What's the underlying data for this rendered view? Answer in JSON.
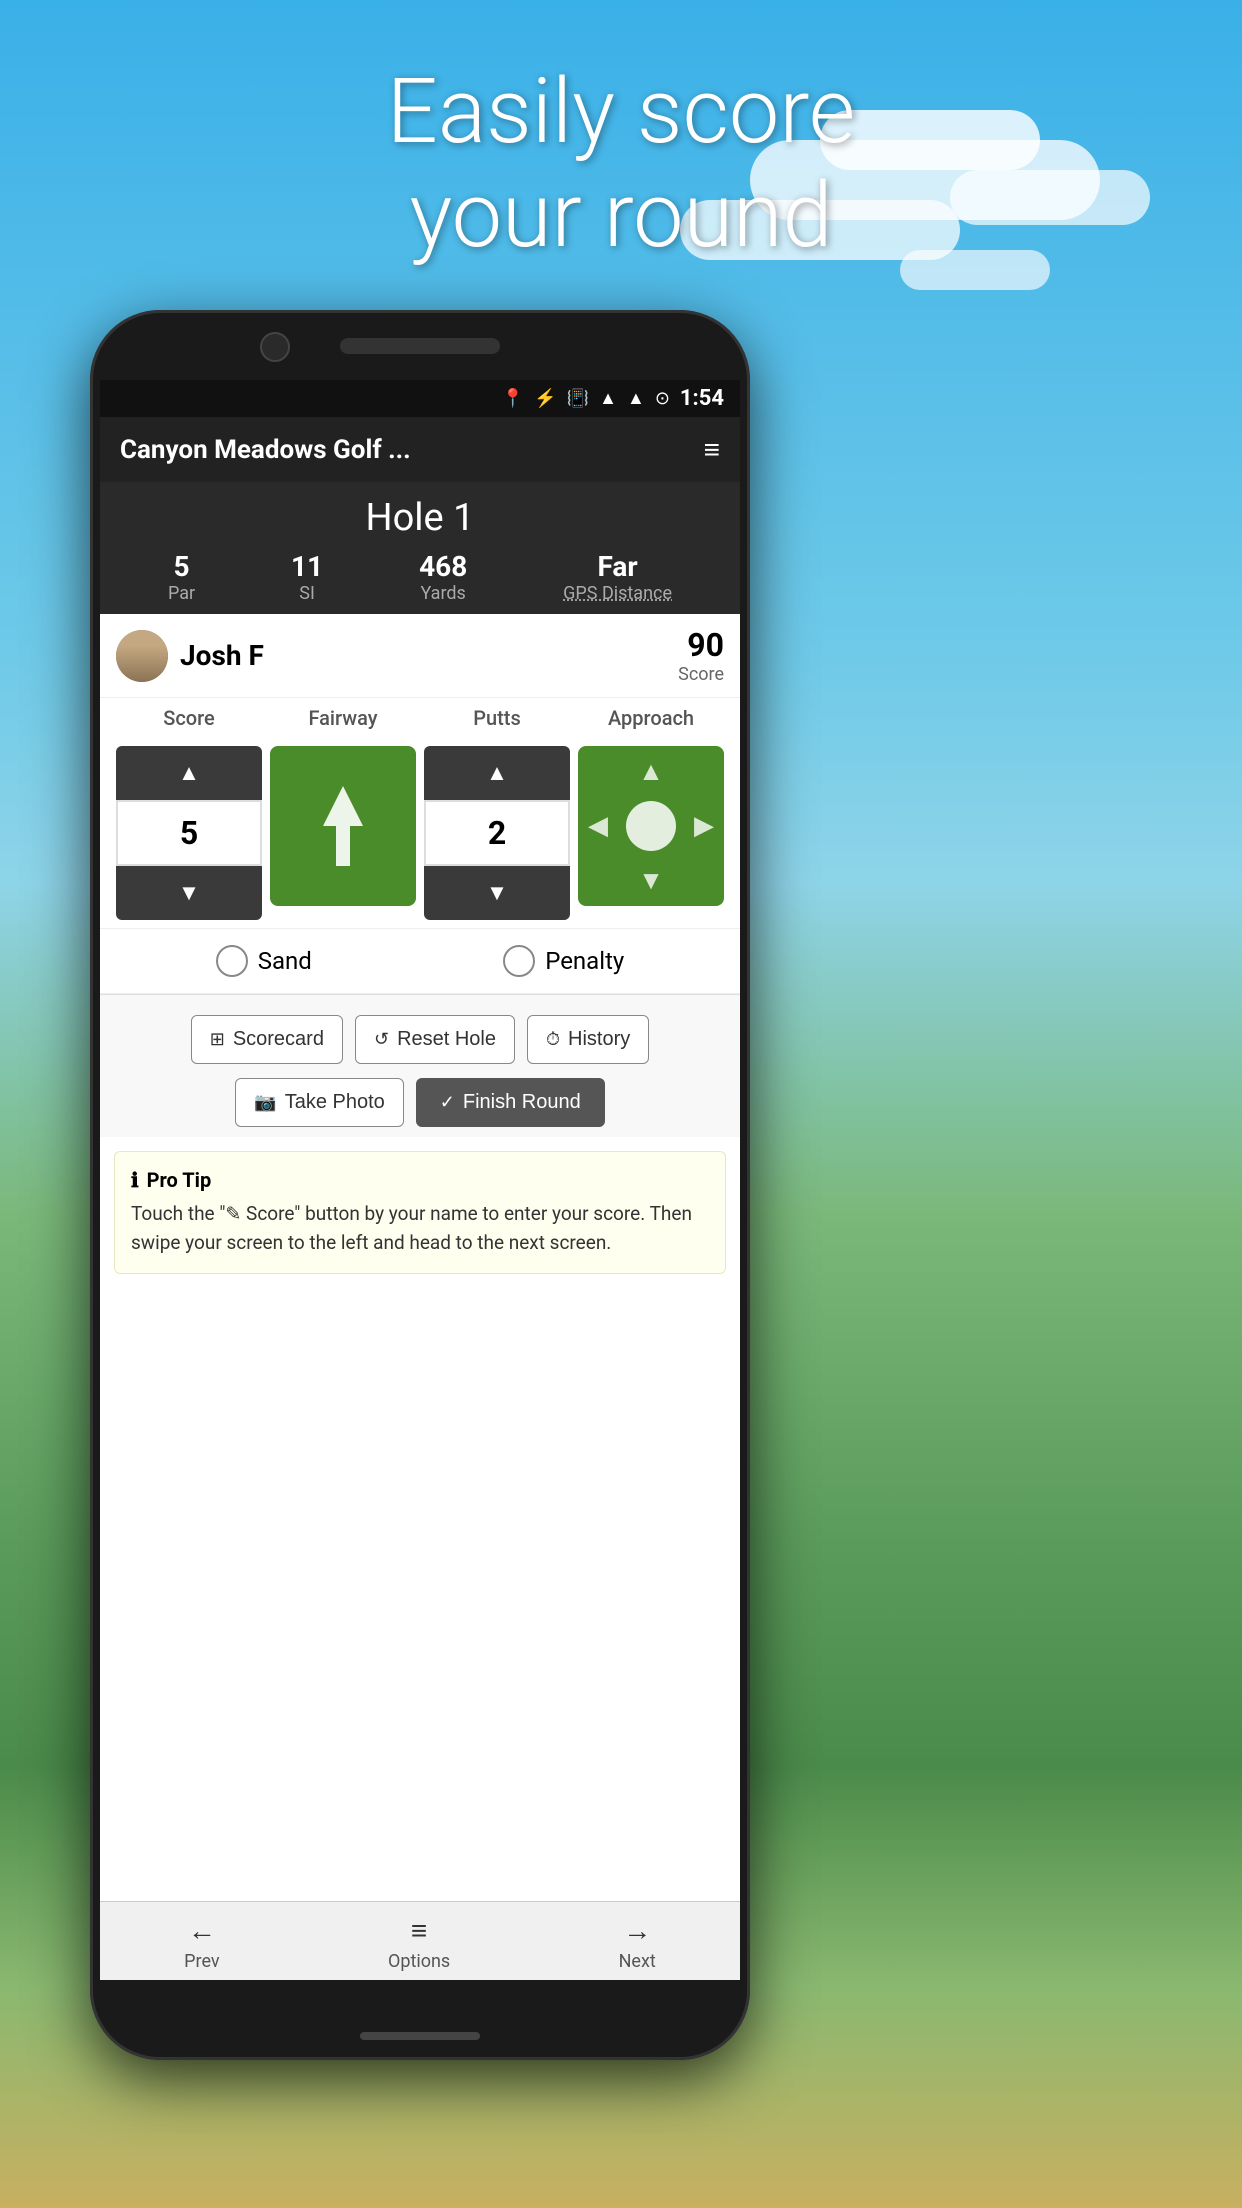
{
  "background": {
    "sky_color": "#3ab0e8",
    "grass_color": "#5a9a5a"
  },
  "hero": {
    "line1": "Easily score",
    "line2": "your round"
  },
  "status_bar": {
    "time": "1:54",
    "icons": [
      "location",
      "bluetooth",
      "vibrate",
      "wifi",
      "signal",
      "alarm"
    ]
  },
  "app_header": {
    "title": "Canyon Meadows Golf ...",
    "menu_icon": "≡"
  },
  "hole_info": {
    "title": "Hole 1",
    "par": {
      "value": "5",
      "label": "Par"
    },
    "si": {
      "value": "11",
      "label": "SI"
    },
    "yards": {
      "value": "468",
      "label": "Yards"
    },
    "gps": {
      "value": "Far",
      "label": "GPS Distance"
    }
  },
  "player": {
    "name": "Josh F",
    "score": "90",
    "score_label": "Score"
  },
  "score_controls": {
    "headers": [
      "Score",
      "Fairway",
      "Putts",
      "Approach"
    ],
    "score_value": "5",
    "putts_value": "2",
    "up_arrow": "▲",
    "down_arrow": "▼"
  },
  "checkboxes": {
    "sand_label": "Sand",
    "penalty_label": "Penalty"
  },
  "action_buttons": {
    "scorecard": "Scorecard",
    "reset_hole": "Reset Hole",
    "history": "History",
    "take_photo": "Take Photo",
    "finish_round": "Finish Round"
  },
  "pro_tip": {
    "title": "Pro Tip",
    "text": "Touch the \"✎ Score\" button by your name to enter your score. Then swipe your screen to the left and head to the next screen."
  },
  "bottom_nav": {
    "prev": {
      "icon": "←",
      "label": "Prev"
    },
    "options": {
      "icon": "≡",
      "label": "Options"
    },
    "next": {
      "icon": "→",
      "label": "Next"
    }
  }
}
